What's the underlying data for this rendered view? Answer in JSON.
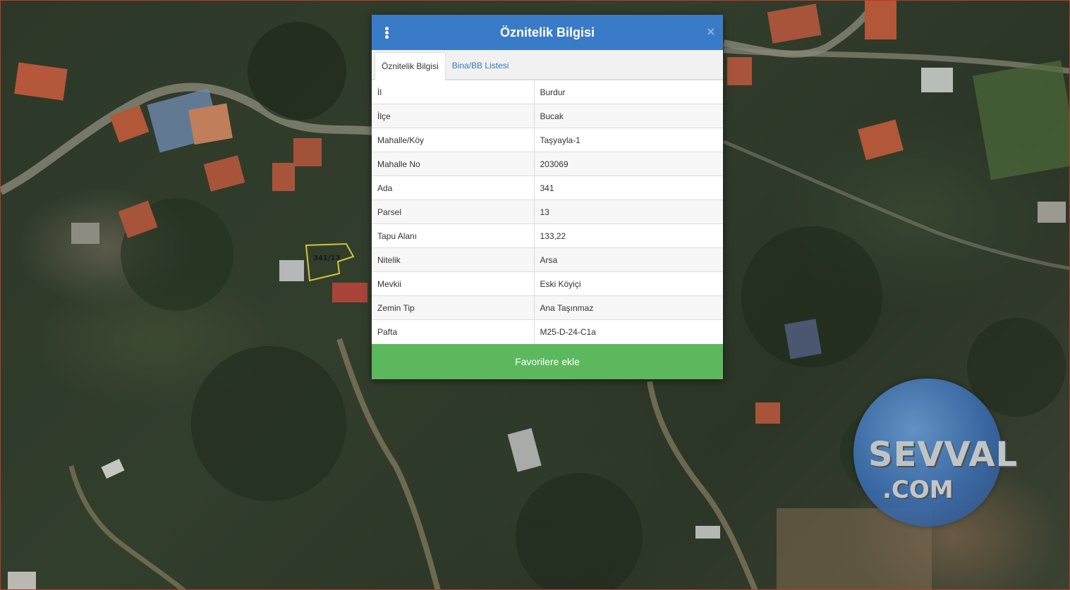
{
  "map": {
    "parcel_label": "341/13"
  },
  "dialog": {
    "title": "Öznitelik Bilgisi",
    "menu_icon": "vertical-ellipsis-icon",
    "close_label": "×",
    "header_color": "#3a7bc8",
    "tabs": [
      {
        "label": "Öznitelik Bilgisi",
        "active": true
      },
      {
        "label": "Bina/BB Listesi",
        "active": false
      }
    ],
    "rows": [
      {
        "key": "İl",
        "value": "Burdur"
      },
      {
        "key": "İlçe",
        "value": "Bucak"
      },
      {
        "key": "Mahalle/Köy",
        "value": "Taşyayla-1"
      },
      {
        "key": "Mahalle No",
        "value": "203069"
      },
      {
        "key": "Ada",
        "value": "341"
      },
      {
        "key": "Parsel",
        "value": "13"
      },
      {
        "key": "Tapu Alanı",
        "value": "133,22"
      },
      {
        "key": "Nitelik",
        "value": "Arsa"
      },
      {
        "key": "Mevkii",
        "value": "Eski Köyiçi"
      },
      {
        "key": "Zemin Tip",
        "value": "Ana Taşınmaz"
      },
      {
        "key": "Pafta",
        "value": "M25-D-24-C1a"
      }
    ],
    "favorite_button": "Favorilere ekle",
    "favorite_color": "#5cb85c"
  },
  "watermark": {
    "line1": "SEVVAL",
    "line2": ".COM"
  }
}
